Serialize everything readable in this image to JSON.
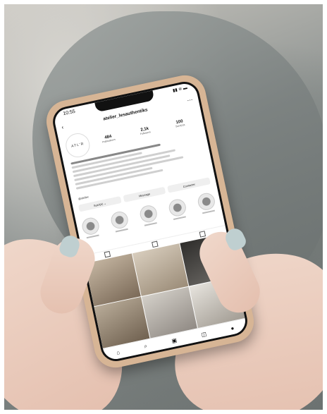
{
  "phone": {
    "status_time": "10:55",
    "status_icons": "▮▮ ≋ ▬",
    "username": "atelier_lesauthentiks",
    "avatar_text": "ATL'R",
    "stats": [
      {
        "n": "484",
        "l": "Publications"
      },
      {
        "n": "2,1k",
        "l": "Followers"
      },
      {
        "n": "100",
        "l": "Suivi(e)s"
      }
    ],
    "link_text": "@atelier",
    "buttons": [
      "Suivi(e) ⌄",
      "Message",
      "Contacter"
    ],
    "icons": {
      "back": "back-arrow-icon",
      "add": "add-post-icon",
      "menu": "menu-icon",
      "home": "home-icon",
      "search": "search-icon",
      "reels": "reels-icon",
      "shop": "shop-icon",
      "profile": "profile-icon"
    }
  }
}
